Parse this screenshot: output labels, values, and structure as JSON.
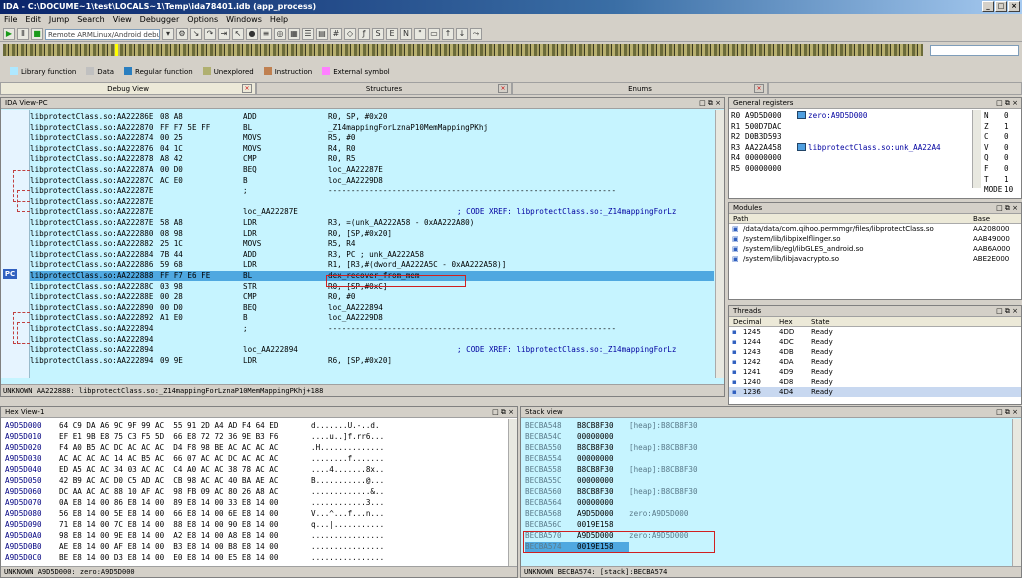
{
  "window": {
    "title": "IDA - C:\\DOCUME~1\\test\\LOCALS~1\\Temp\\ida78401.idb (app_process)"
  },
  "menu": [
    "File",
    "Edit",
    "Jump",
    "Search",
    "View",
    "Debugger",
    "Options",
    "Windows",
    "Help"
  ],
  "toolbar": {
    "debugger_select": "Remote ARMLinux/Android debugger"
  },
  "legend": [
    {
      "label": "Library function",
      "color": "#aee8ff"
    },
    {
      "label": "Data",
      "color": "#c0c0c0"
    },
    {
      "label": "Regular function",
      "color": "#2a7fc0"
    },
    {
      "label": "Unexplored",
      "color": "#b0b070"
    },
    {
      "label": "Instruction",
      "color": "#c08050"
    },
    {
      "label": "External symbol",
      "color": "#ff80ff"
    }
  ],
  "tabs": {
    "debug_view": "Debug View",
    "structures": "Structures",
    "enums": "Enums"
  },
  "ida": {
    "title": "IDA View-PC",
    "pc_badge": "PC",
    "lines": [
      {
        "a": "libprotectClass.so:AA22286E",
        "b": "08 A8",
        "m": "ADD",
        "o": "R0, SP, #0x20",
        "c": ""
      },
      {
        "a": "libprotectClass.so:AA222870",
        "b": "FF F7 5E FF",
        "m": "BL",
        "o": "_Z14mappingForLznaP10MemMappingPKhj",
        "c": ""
      },
      {
        "a": "libprotectClass.so:AA222874",
        "b": "00 25",
        "m": "MOVS",
        "o": "R5, #0",
        "c": ""
      },
      {
        "a": "libprotectClass.so:AA222876",
        "b": "04 1C",
        "m": "MOVS",
        "o": "R4, R0",
        "c": ""
      },
      {
        "a": "libprotectClass.so:AA222878",
        "b": "A8 42",
        "m": "CMP",
        "o": "R0, R5",
        "c": ""
      },
      {
        "a": "libprotectClass.so:AA22287A",
        "b": "00 D0",
        "m": "BEQ",
        "o": "loc_AA22287E",
        "c": ""
      },
      {
        "a": "libprotectClass.so:AA22287C",
        "b": "AC E0",
        "m": "B",
        "o": "loc_AA2229D8",
        "c": ""
      },
      {
        "a": "libprotectClass.so:AA22287E",
        "b": "",
        "m": ";",
        "o": "---------------------------------------------------------------",
        "c": ""
      },
      {
        "a": "libprotectClass.so:AA22287E",
        "b": "",
        "m": "",
        "o": "",
        "c": ""
      },
      {
        "a": "libprotectClass.so:AA22287E",
        "b": "",
        "m": "loc_AA22287E",
        "o": "",
        "c": "; CODE XREF: libprotectClass.so:_Z14mappingForLz"
      },
      {
        "a": "libprotectClass.so:AA22287E",
        "b": "58 A8",
        "m": "LDR",
        "o": "R3, =(unk_AA222A58 - 0xAA222A80)",
        "c": ""
      },
      {
        "a": "libprotectClass.so:AA222880",
        "b": "08 98",
        "m": "LDR",
        "o": "R0, [SP,#0x20]",
        "c": ""
      },
      {
        "a": "libprotectClass.so:AA222882",
        "b": "25 1C",
        "m": "MOVS",
        "o": "R5, R4",
        "c": ""
      },
      {
        "a": "libprotectClass.so:AA222884",
        "b": "7B 44",
        "m": "ADD",
        "o": "R3, PC ; unk_AA222A58",
        "c": ""
      },
      {
        "a": "libprotectClass.so:AA222886",
        "b": "59 68",
        "m": "LDR",
        "o": "R1, [R3,#(dword_AA222A5C - 0xAA222A58)]",
        "c": ""
      },
      {
        "a": "libprotectClass.so:AA222888",
        "b": "FF F7 E6 FE",
        "m": "BL",
        "o": "dex_recover_from_mem",
        "c": ""
      },
      {
        "a": "libprotectClass.so:AA22288C",
        "b": "03 98",
        "m": "STR",
        "o": "R0, [SP,#0xC]",
        "c": ""
      },
      {
        "a": "libprotectClass.so:AA22288E",
        "b": "00 28",
        "m": "CMP",
        "o": "R0, #0",
        "c": ""
      },
      {
        "a": "libprotectClass.so:AA222890",
        "b": "00 D0",
        "m": "BEQ",
        "o": "loc_AA222894",
        "c": ""
      },
      {
        "a": "libprotectClass.so:AA222892",
        "b": "A1 E0",
        "m": "B",
        "o": "loc_AA2229D8",
        "c": ""
      },
      {
        "a": "libprotectClass.so:AA222894",
        "b": "",
        "m": ";",
        "o": "---------------------------------------------------------------",
        "c": ""
      },
      {
        "a": "libprotectClass.so:AA222894",
        "b": "",
        "m": "",
        "o": "",
        "c": ""
      },
      {
        "a": "libprotectClass.so:AA222894",
        "b": "",
        "m": "loc_AA222894",
        "o": "",
        "c": "; CODE XREF: libprotectClass.so:_Z14mappingForLz"
      },
      {
        "a": "libprotectClass.so:AA222894",
        "b": "09 9E",
        "m": "LDR",
        "o": "R6, [SP,#0x20]",
        "c": ""
      }
    ],
    "status": "UNKNOWN AA222888: libprotectClass.so:_Z14mappingForLznaP10MemMappingPKhj+188"
  },
  "registers": {
    "title": "General registers",
    "rows": [
      {
        "n": "R0",
        "v": "A9D5D000",
        "l": "zero:A9D5D000"
      },
      {
        "n": "R1",
        "v": "500D7DAC",
        "l": ""
      },
      {
        "n": "R2",
        "v": "D0B3D593",
        "l": ""
      },
      {
        "n": "R3",
        "v": "AA22A458",
        "l": "libprotectClass.so:unk_AA22A4"
      },
      {
        "n": "R4",
        "v": "00000000",
        "l": ""
      },
      {
        "n": "R5",
        "v": "00000000",
        "l": ""
      }
    ],
    "flags": [
      {
        "n": "N",
        "v": "0"
      },
      {
        "n": "Z",
        "v": "1"
      },
      {
        "n": "C",
        "v": "0"
      },
      {
        "n": "V",
        "v": "0"
      },
      {
        "n": "Q",
        "v": "0"
      },
      {
        "n": "F",
        "v": "0"
      },
      {
        "n": "T",
        "v": "1"
      },
      {
        "n": "MODE",
        "v": "10"
      }
    ]
  },
  "modules": {
    "title": "Modules",
    "cols": [
      "Path",
      "Base"
    ],
    "rows": [
      {
        "p": "/data/data/com.qihoo.permmgr/files/libprotectClass.so",
        "b": "AA208000"
      },
      {
        "p": "/system/lib/libpixelflinger.so",
        "b": "AAB49000"
      },
      {
        "p": "/system/lib/egl/libGLES_android.so",
        "b": "AAB6A000"
      },
      {
        "p": "/system/lib/libjavacrypto.so",
        "b": "ABE2E000"
      }
    ]
  },
  "threads": {
    "title": "Threads",
    "cols": [
      "Decimal",
      "Hex",
      "State"
    ],
    "rows": [
      {
        "d": "1245",
        "h": "4DD",
        "s": "Ready"
      },
      {
        "d": "1244",
        "h": "4DC",
        "s": "Ready"
      },
      {
        "d": "1243",
        "h": "4DB",
        "s": "Ready"
      },
      {
        "d": "1242",
        "h": "4DA",
        "s": "Ready"
      },
      {
        "d": "1241",
        "h": "4D9",
        "s": "Ready"
      },
      {
        "d": "1240",
        "h": "4D8",
        "s": "Ready"
      },
      {
        "d": "1236",
        "h": "4D4",
        "s": "Ready"
      }
    ]
  },
  "hex": {
    "title": "Hex View-1",
    "rows": [
      {
        "a": "A9D5D000",
        "b": "64 C9 DA A6 9C 9F 99 AC  55 91 2D A4 AD F4 64 ED",
        "c": "d.......U.-..d."
      },
      {
        "a": "A9D5D010",
        "b": "EF E1 9B E8 75 C3 F5 5D  66 E8 72 72 36 9E B3 F6",
        "c": "....u..]f.rr6..."
      },
      {
        "a": "A9D5D020",
        "b": "F4 A0 B5 AC DC AC AC AC  D4 F8 98 BE AC AC AC AC",
        "c": ".H.............."
      },
      {
        "a": "A9D5D030",
        "b": "AC AC AC AC 14 AC B5 AC  66 07 AC AC DC AC AC AC",
        "c": "........f......."
      },
      {
        "a": "A9D5D040",
        "b": "ED A5 AC AC 34 03 AC AC  C4 A0 AC AC 38 78 AC AC",
        "c": "....4.......8x.."
      },
      {
        "a": "A9D5D050",
        "b": "42 B9 AC AC D0 C5 AD AC  CB 98 AC AC 40 BA AE AC",
        "c": "B...........@..."
      },
      {
        "a": "A9D5D060",
        "b": "DC AA AC AC 88 10 AF AC  98 FB 09 AC 80 26 A8 AC",
        "c": ".............&.."
      },
      {
        "a": "A9D5D070",
        "b": "0A E8 14 00 86 E8 14 00  89 E8 14 00 33 E8 14 00",
        "c": "............3..."
      },
      {
        "a": "A9D5D080",
        "b": "56 E8 14 00 5E E8 14 00  66 E8 14 00 6E E8 14 00",
        "c": "V...^...f...n..."
      },
      {
        "a": "A9D5D090",
        "b": "71 E8 14 00 7C E8 14 00  88 E8 14 00 90 E8 14 00",
        "c": "q...|..........."
      },
      {
        "a": "A9D5D0A0",
        "b": "98 E8 14 00 9E E8 14 00  A2 E8 14 00 A8 E8 14 00",
        "c": "................"
      },
      {
        "a": "A9D5D0B0",
        "b": "AE E8 14 00 AF E8 14 00  B3 E8 14 00 B8 E8 14 00",
        "c": "................"
      },
      {
        "a": "A9D5D0C0",
        "b": "BE E8 14 00 D3 E8 14 00  E0 E8 14 00 E5 E8 14 00",
        "c": "................"
      }
    ],
    "status": "UNKNOWN A9D5D000: zero:A9D5D000"
  },
  "stack": {
    "title": "Stack view",
    "rows": [
      {
        "a": "BECBA548",
        "v": "B8CB8F30",
        "d": "[heap]:B8CB8F30"
      },
      {
        "a": "BECBA54C",
        "v": "00000000",
        "d": ""
      },
      {
        "a": "BECBA550",
        "v": "B8CB8F30",
        "d": "[heap]:B8CB8F30"
      },
      {
        "a": "BECBA554",
        "v": "00000000",
        "d": ""
      },
      {
        "a": "BECBA558",
        "v": "B8CB8F30",
        "d": "[heap]:B8CB8F30"
      },
      {
        "a": "BECBA55C",
        "v": "00000000",
        "d": ""
      },
      {
        "a": "BECBA560",
        "v": "B8CB8F30",
        "d": "[heap]:B8CB8F30"
      },
      {
        "a": "BECBA564",
        "v": "00000000",
        "d": ""
      },
      {
        "a": "BECBA568",
        "v": "A9D5D000",
        "d": "zero:A9D5D000"
      },
      {
        "a": "BECBA56C",
        "v": "0019E158",
        "d": ""
      },
      {
        "a": "BECBA570",
        "v": "A9D5D000",
        "d": "zero:A9D5D000"
      },
      {
        "a": "BECBA574",
        "v": "0019E158",
        "d": ""
      }
    ],
    "status": "UNKNOWN BECBA574: [stack]:BECBA574"
  }
}
